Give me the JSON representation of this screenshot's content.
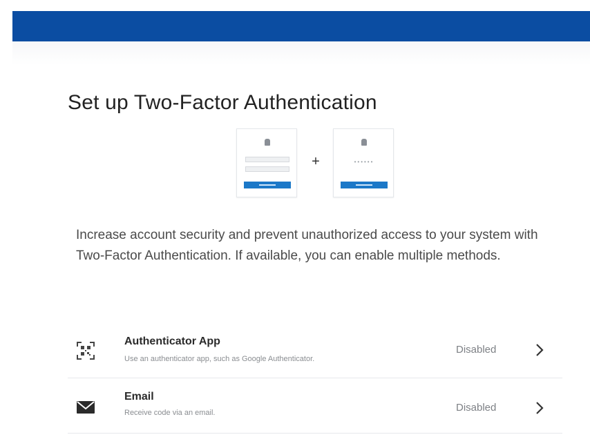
{
  "header": {
    "color": "#0b4da2"
  },
  "title": "Set up Two-Factor Authentication",
  "illustration": {
    "plus": "+",
    "code_dots": "••••••",
    "icons": [
      "login-form-card-icon",
      "verification-code-card-icon"
    ]
  },
  "description": "Increase account security and prevent unauthorized access to your system with Two-Factor Authentication. If available, you can enable multiple methods.",
  "methods": [
    {
      "name": "Authenticator App",
      "subtitle": "Use an authenticator app, such as Google Authenticator.",
      "status": "Disabled",
      "icon": "qr-scan-icon"
    },
    {
      "name": "Email",
      "subtitle": "Receive code via an email.",
      "status": "Disabled",
      "icon": "envelope-icon"
    }
  ]
}
